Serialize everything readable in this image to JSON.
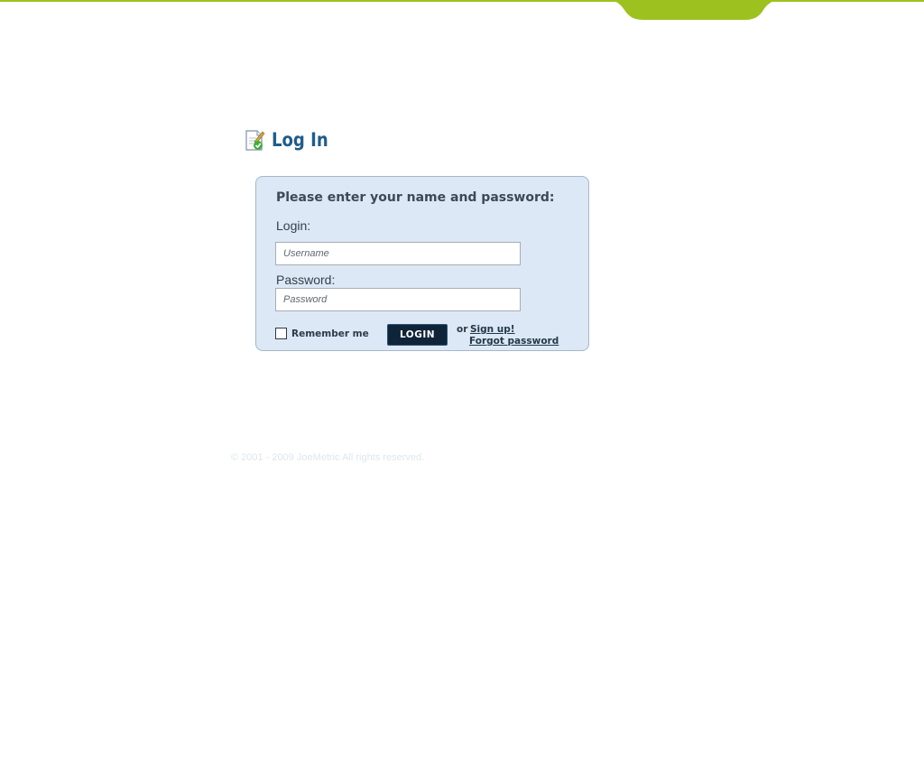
{
  "header": {
    "brand_color": "#9dc21f",
    "title": "Log In",
    "title_icon": "document-check-icon"
  },
  "login_form": {
    "heading": "Please enter your name and password:",
    "login_label": "Login:",
    "username_placeholder": "Username",
    "password_label": "Password:",
    "password_placeholder": "Password",
    "remember_label": "Remember me",
    "remember_checked": false,
    "login_button": "LOGIN",
    "or_text": "or",
    "signup_link": "Sign up!",
    "forgot_link": "Forgot password"
  },
  "colors": {
    "panel_background": "#dce8f5",
    "panel_border": "#a4b7c9",
    "button_background": "#0f2438",
    "title_color": "#1f5d8c"
  },
  "footer": {
    "copyright": "© 2001 - 2009 JoeMetric All rights reserved."
  }
}
